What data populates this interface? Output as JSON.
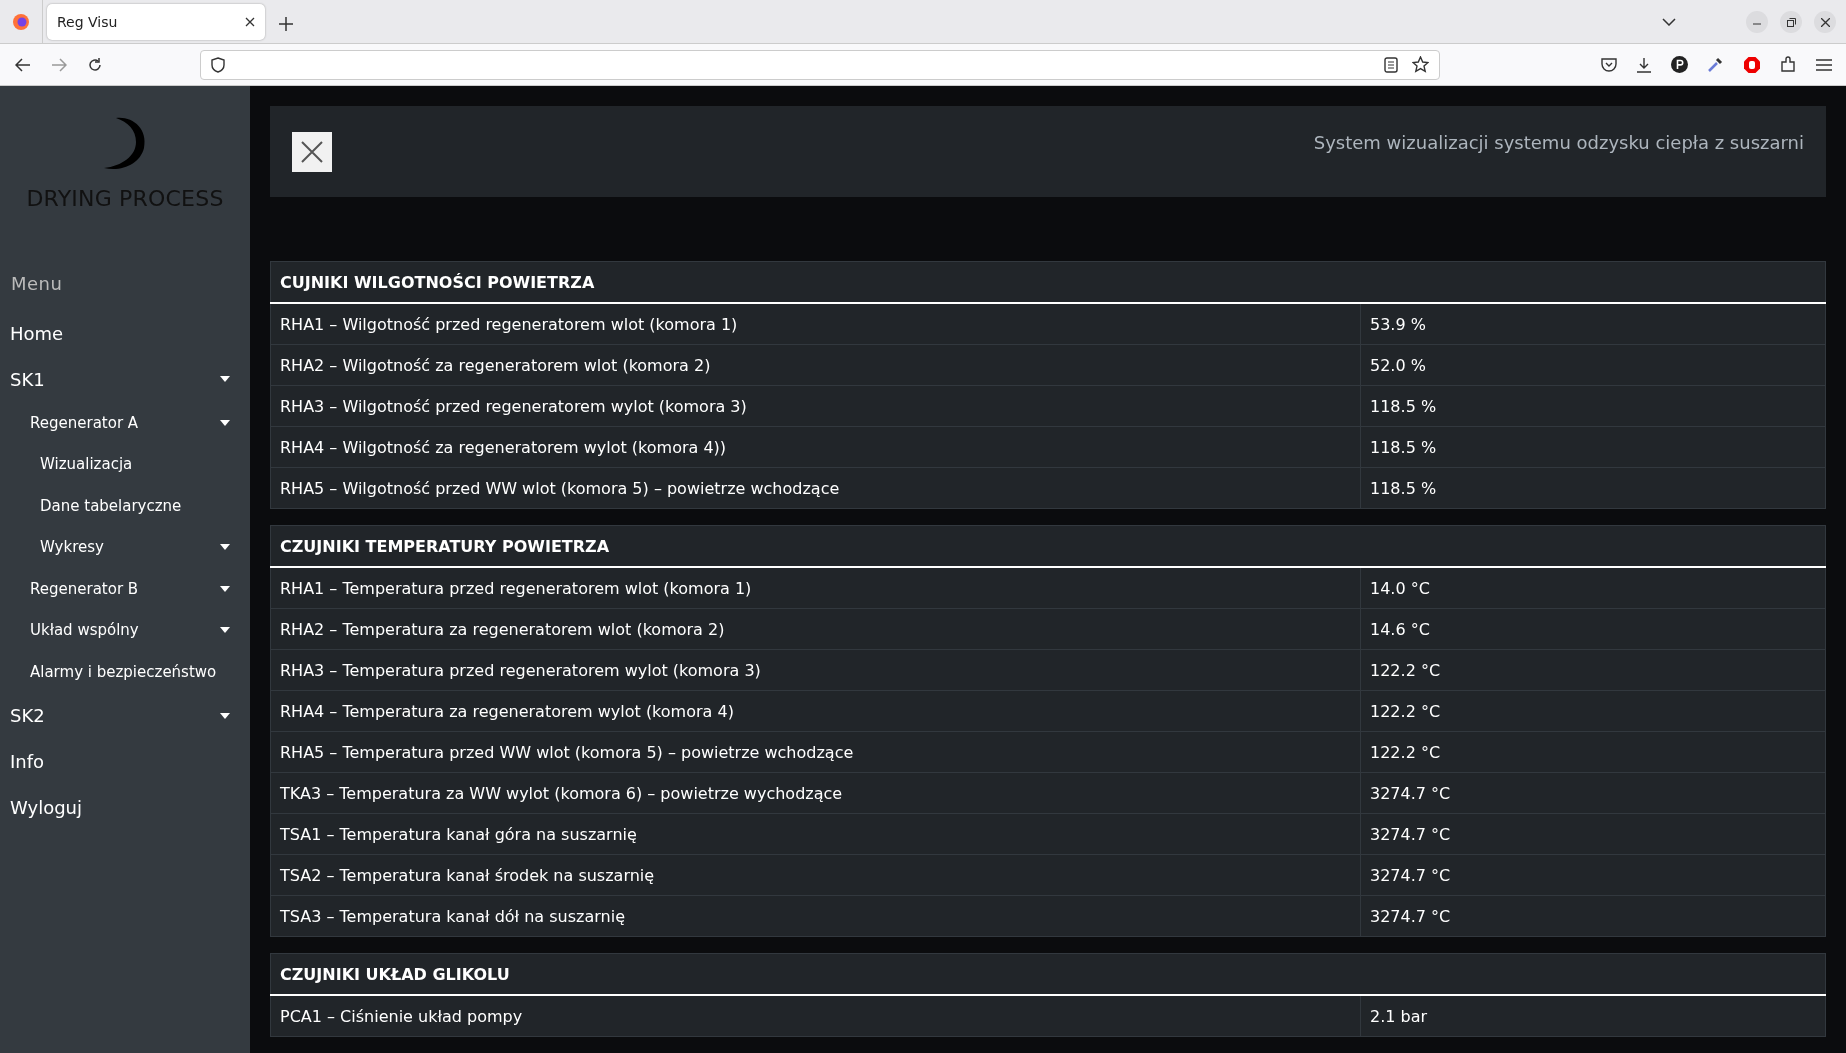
{
  "browser": {
    "tab_title": "Reg Visu"
  },
  "sidebar": {
    "logo_text": "DRYING PROCESS",
    "menu_label": "Menu",
    "items": [
      {
        "label": "Home",
        "kind": "link"
      },
      {
        "label": "SK1",
        "kind": "dropdown",
        "children": [
          {
            "label": "Regenerator A",
            "kind": "dropdown",
            "children": [
              {
                "label": "Wizualizacja",
                "kind": "link"
              },
              {
                "label": "Dane tabelaryczne",
                "kind": "link"
              },
              {
                "label": "Wykresy",
                "kind": "dropdown"
              }
            ]
          },
          {
            "label": "Regenerator B",
            "kind": "dropdown"
          },
          {
            "label": "Układ wspólny",
            "kind": "dropdown"
          },
          {
            "label": "Alarmy i bezpieczeństwo",
            "kind": "link"
          }
        ]
      },
      {
        "label": "SK2",
        "kind": "dropdown"
      },
      {
        "label": "Info",
        "kind": "link"
      },
      {
        "label": "Wyloguj",
        "kind": "link"
      }
    ]
  },
  "header": {
    "subtitle": "System wizualizacji systemu odzysku ciepła z suszarni"
  },
  "tables": [
    {
      "title": "CUJNIKI WILGOTNOŚCI POWIETRZA",
      "rows": [
        [
          "RHA1 – Wilgotność przed regeneratorem wlot (komora 1)",
          "53.9 %"
        ],
        [
          "RHA2 – Wilgotność za regeneratorem wlot (komora 2)",
          "52.0 %"
        ],
        [
          "RHA3 – Wilgotność przed regeneratorem wylot (komora 3)",
          "118.5 %"
        ],
        [
          "RHA4 – Wilgotność za regeneratorem wylot (komora 4))",
          "118.5 %"
        ],
        [
          "RHA5 – Wilgotność przed WW wlot (komora 5) – powietrze wchodzące",
          "118.5 %"
        ]
      ]
    },
    {
      "title": "CZUJNIKI TEMPERATURY POWIETRZA",
      "rows": [
        [
          "RHA1 – Temperatura przed regeneratorem wlot (komora 1)",
          "14.0 °C"
        ],
        [
          "RHA2 – Temperatura za regeneratorem wlot (komora 2)",
          "14.6 °C"
        ],
        [
          "RHA3 – Temperatura przed regeneratorem wylot (komora 3)",
          "122.2 °C"
        ],
        [
          "RHA4 – Temperatura za regeneratorem wylot (komora 4)",
          "122.2 °C"
        ],
        [
          "RHA5 – Temperatura przed WW wlot (komora 5) – powietrze wchodzące",
          "122.2 °C"
        ],
        [
          "TKA3 – Temperatura za WW wylot (komora 6) – powietrze wychodzące",
          "3274.7 °C"
        ],
        [
          "TSA1 – Temperatura kanał góra na suszarnię",
          "3274.7 °C"
        ],
        [
          "TSA2 – Temperatura kanał środek na suszarnię",
          "3274.7 °C"
        ],
        [
          "TSA3 – Temperatura kanał dół na suszarnię",
          "3274.7 °C"
        ]
      ]
    },
    {
      "title": "CZUJNIKI UKŁAD GLIKOLU",
      "rows": [
        [
          "PCA1 – Ciśnienie układ pompy",
          "2.1 bar"
        ]
      ]
    }
  ]
}
